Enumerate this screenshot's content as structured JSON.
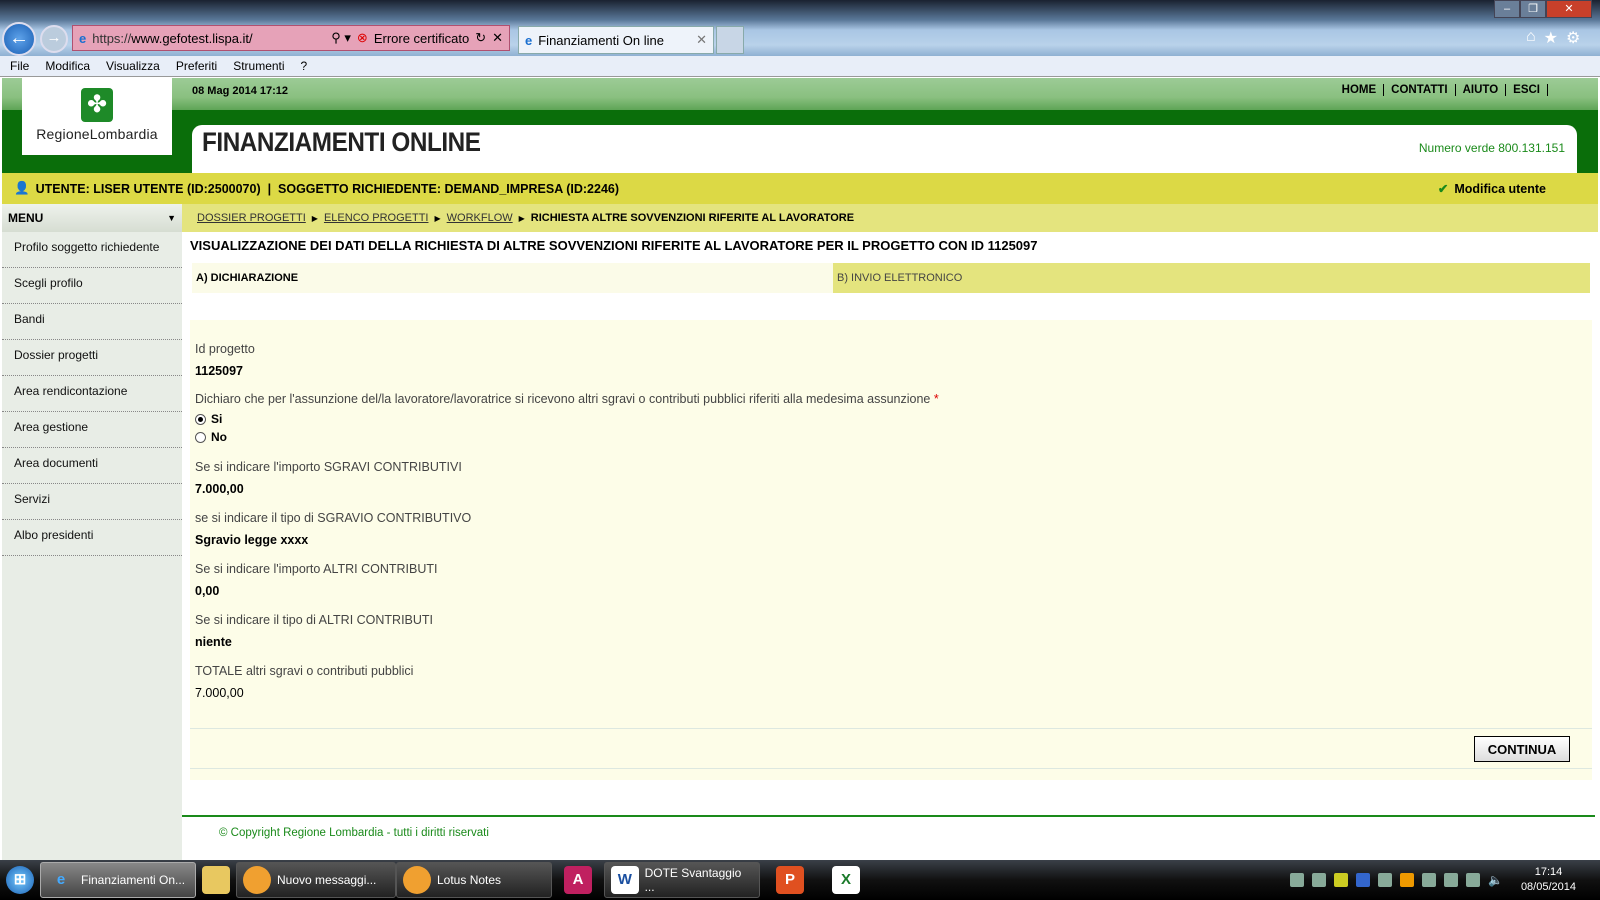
{
  "browser": {
    "url_prefix": "https://",
    "url_host": "www.gefotest.lispa.it/",
    "cert_error": "Errore certificato",
    "tab_title": "Finanziamenti On line",
    "menu": [
      "File",
      "Modifica",
      "Visualizza",
      "Preferiti",
      "Strumenti",
      "?"
    ]
  },
  "header": {
    "date": "08 Mag 2014 17:12",
    "logo_text": "RegioneLombardia",
    "title": "FINANZIAMENTI ONLINE",
    "numero_verde": "Numero verde 800.131.151",
    "links": [
      "HOME",
      "CONTATTI",
      "AIUTO",
      "ESCI"
    ]
  },
  "userbar": {
    "text": "UTENTE: LISER UTENTE (ID:2500070)  |  SOGGETTO RICHIEDENTE: DEMAND_IMPRESA (ID:2246)",
    "modify": "Modifica utente"
  },
  "sidebar": {
    "title": "MENU",
    "items": [
      "Profilo soggetto richiedente",
      "Scegli profilo",
      "Bandi",
      "Dossier progetti",
      "Area rendicontazione",
      "Area gestione",
      "Area documenti",
      "Servizi",
      "Albo presidenti"
    ]
  },
  "breadcrumb": {
    "links": [
      "DOSSIER PROGETTI",
      "ELENCO PROGETTI",
      "WORKFLOW"
    ],
    "current": "RICHIESTA ALTRE SOVVENZIONI RIFERITE AL LAVORATORE"
  },
  "page_title": "VISUALIZZAZIONE DEI DATI DELLA RICHIESTA DI ALTRE SOVVENZIONI RIFERITE AL LAVORATORE PER IL PROGETTO CON ID 1125097",
  "steps": {
    "a": "A) DICHIARAZIONE",
    "b": "B) INVIO ELETTRONICO"
  },
  "form": {
    "id_label": "Id progetto",
    "id_value": "1125097",
    "declare_label": "Dichiaro che per l'assunzione del/la lavoratore/lavoratrice si ricevono altri sgravi o contributi pubblici riferiti alla medesima assunzione",
    "required": "*",
    "radio": {
      "si": "Si",
      "no": "No",
      "selected": "Si"
    },
    "fields": [
      {
        "label": "Se si indicare l'importo SGRAVI CONTRIBUTIVI",
        "value": "7.000,00"
      },
      {
        "label": "se si indicare il tipo di SGRAVIO CONTRIBUTIVO",
        "value": "Sgravio legge xxxx"
      },
      {
        "label": "Se si indicare l'importo ALTRI CONTRIBUTI",
        "value": "0,00"
      },
      {
        "label": "Se si indicare il tipo di ALTRI CONTRIBUTI",
        "value": "niente"
      },
      {
        "label": "TOTALE altri sgravi o contributi pubblici",
        "value": "7.000,00"
      }
    ],
    "continue": "CONTINUA"
  },
  "footer": {
    "copyright": "© Copyright Regione Lombardia - tutti i diritti riservati"
  },
  "taskbar": {
    "items": [
      "Finanziamenti On...",
      "Nuovo messaggi...",
      "Lotus Notes",
      "DOTE Svantaggio ..."
    ],
    "time": "17:14",
    "date": "08/05/2014"
  },
  "colors": {
    "green": "#0a6e0a",
    "yellow": "#dcd945",
    "light_yellow": "#e4e47e",
    "form_bg": "#fdfde8"
  }
}
